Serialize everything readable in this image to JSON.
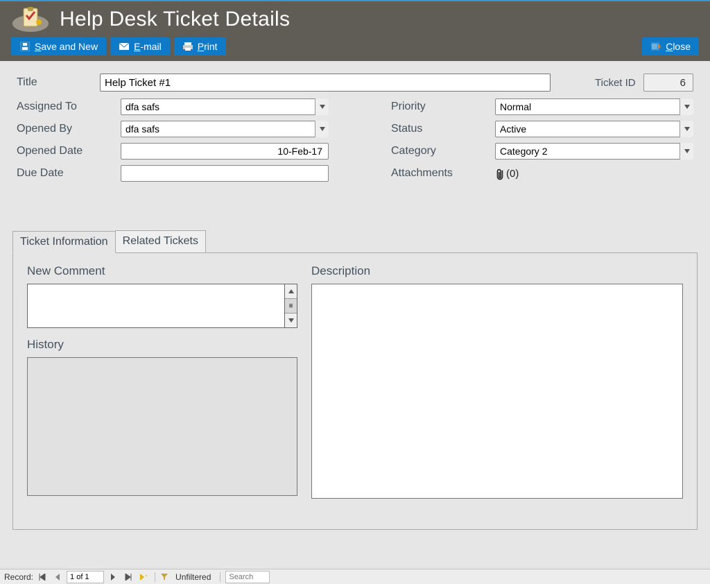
{
  "header": {
    "title": "Help Desk Ticket Details"
  },
  "toolbar": {
    "save_new": "Save and New",
    "save_new_accel": "S",
    "email": "E-mail",
    "email_accel": "E",
    "print": "Print",
    "print_accel": "P",
    "close": "Close",
    "close_accel": "C"
  },
  "form": {
    "title_label": "Title",
    "title_value": "Help Ticket #1",
    "ticket_id_label": "Ticket ID",
    "ticket_id_value": "6",
    "assigned_to_label": "Assigned To",
    "assigned_to_value": "dfa safs",
    "opened_by_label": "Opened By",
    "opened_by_value": "dfa safs",
    "opened_date_label": "Opened Date",
    "opened_date_value": "10-Feb-17",
    "due_date_label": "Due Date",
    "due_date_value": "",
    "priority_label": "Priority",
    "priority_value": "Normal",
    "status_label": "Status",
    "status_value": "Active",
    "category_label": "Category",
    "category_value": "Category 2",
    "attachments_label": "Attachments",
    "attachments_count": "(0)"
  },
  "tabs": {
    "info": "Ticket Information",
    "related": "Related Tickets"
  },
  "panel": {
    "new_comment_label": "New Comment",
    "history_label": "History",
    "description_label": "Description"
  },
  "statusbar": {
    "record_label": "Record:",
    "position": "1 of 1",
    "unfiltered": "Unfiltered",
    "search_placeholder": "Search"
  }
}
